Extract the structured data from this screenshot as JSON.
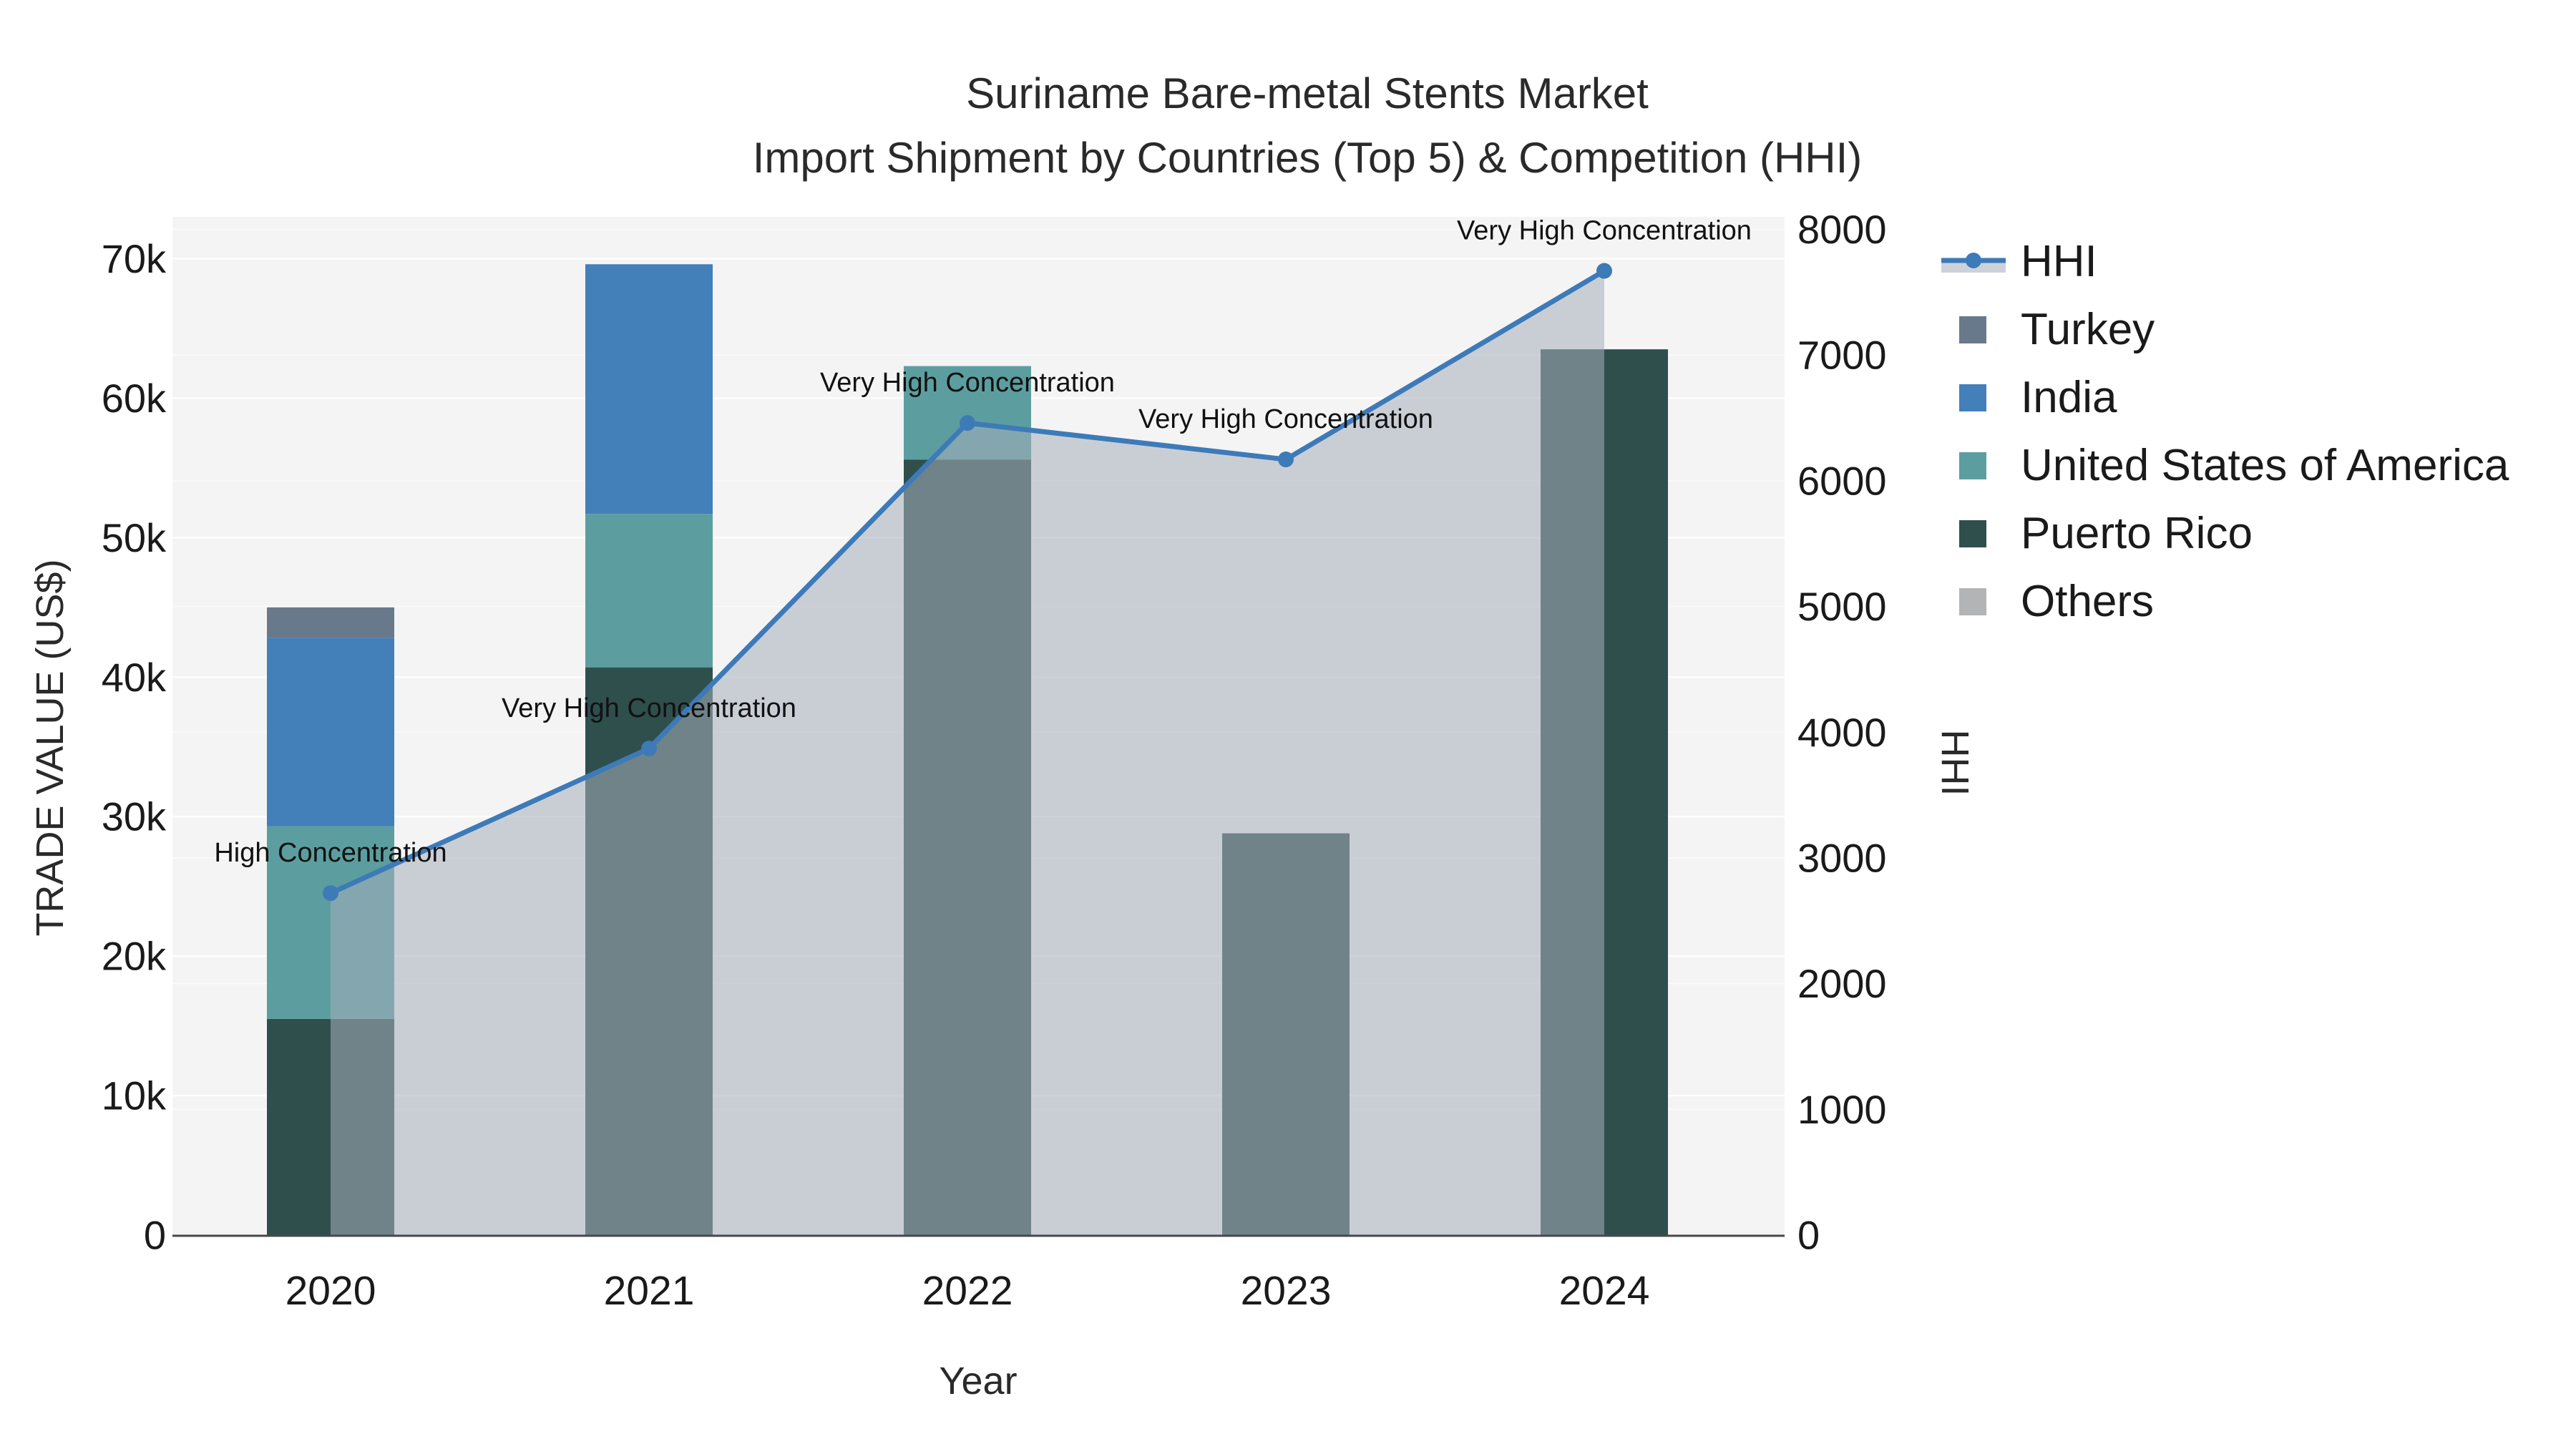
{
  "title": {
    "line1": "Suriname Bare-metal Stents Market",
    "line2": "Import Shipment by Countries (Top 5) & Competition (HHI)"
  },
  "axes": {
    "x_title": "Year",
    "y_left_title": "TRADE VALUE (US$)",
    "y_right_title": "HHI",
    "x_ticks": [
      "2020",
      "2021",
      "2022",
      "2023",
      "2024"
    ],
    "y_left_ticks": [
      {
        "v": 0,
        "label": "0"
      },
      {
        "v": 10000,
        "label": "10k"
      },
      {
        "v": 20000,
        "label": "20k"
      },
      {
        "v": 30000,
        "label": "30k"
      },
      {
        "v": 40000,
        "label": "40k"
      },
      {
        "v": 50000,
        "label": "50k"
      },
      {
        "v": 60000,
        "label": "60k"
      },
      {
        "v": 70000,
        "label": "70k"
      }
    ],
    "y_right_ticks": [
      {
        "v": 0,
        "label": "0"
      },
      {
        "v": 1000,
        "label": "1000"
      },
      {
        "v": 2000,
        "label": "2000"
      },
      {
        "v": 3000,
        "label": "3000"
      },
      {
        "v": 4000,
        "label": "4000"
      },
      {
        "v": 5000,
        "label": "5000"
      },
      {
        "v": 6000,
        "label": "6000"
      },
      {
        "v": 7000,
        "label": "7000"
      },
      {
        "v": 8000,
        "label": "8000"
      }
    ]
  },
  "chart_data": {
    "type": "combo",
    "subtype": "stacked-bar + line-with-area",
    "categories": [
      "2020",
      "2021",
      "2022",
      "2023",
      "2024"
    ],
    "bar_series": [
      {
        "name": "Puerto Rico",
        "color": "#2f4f4c",
        "values": [
          15500,
          40700,
          55600,
          28800,
          63500
        ]
      },
      {
        "name": "United States of America",
        "color": "#5c9ea0",
        "values": [
          13800,
          11000,
          6700,
          0,
          0
        ]
      },
      {
        "name": "India",
        "color": "#437fb8",
        "values": [
          13500,
          17900,
          0,
          0,
          0
        ]
      },
      {
        "name": "Turkey",
        "color": "#68798b",
        "values": [
          2200,
          0,
          0,
          0,
          0
        ]
      },
      {
        "name": "Others",
        "color": "#b2b4b6",
        "values": [
          0,
          0,
          0,
          0,
          0
        ]
      }
    ],
    "line_series": {
      "name": "HHI",
      "axis": "right",
      "color": "#3d7ab8",
      "area_fill": "rgba(165,174,188,0.55)",
      "values": [
        2720,
        3870,
        6460,
        6170,
        7670
      ]
    },
    "annotations": [
      "High Concentration",
      "Very High Concentration",
      "Very High Concentration",
      "Very High Concentration",
      "Very High Concentration"
    ],
    "xlabel": "Year",
    "ylabel_left": "TRADE VALUE (US$)",
    "ylabel_right": "HHI",
    "ylim_left": [
      0,
      73000
    ],
    "ylim_right": [
      0,
      8100
    ],
    "grid": "on",
    "legend_position": "right",
    "plot_bg": "#f4f4f4",
    "axis_line_color": "#484848"
  },
  "legend": {
    "items": [
      {
        "label": "HHI",
        "type": "line"
      },
      {
        "label": "Turkey",
        "type": "square",
        "color": "#68798b"
      },
      {
        "label": "India",
        "type": "square",
        "color": "#437fb8"
      },
      {
        "label": "United States of America",
        "type": "square",
        "color": "#5c9ea0"
      },
      {
        "label": "Puerto Rico",
        "type": "square",
        "color": "#2f4f4c"
      },
      {
        "label": "Others",
        "type": "square",
        "color": "#b2b4b6"
      }
    ]
  }
}
